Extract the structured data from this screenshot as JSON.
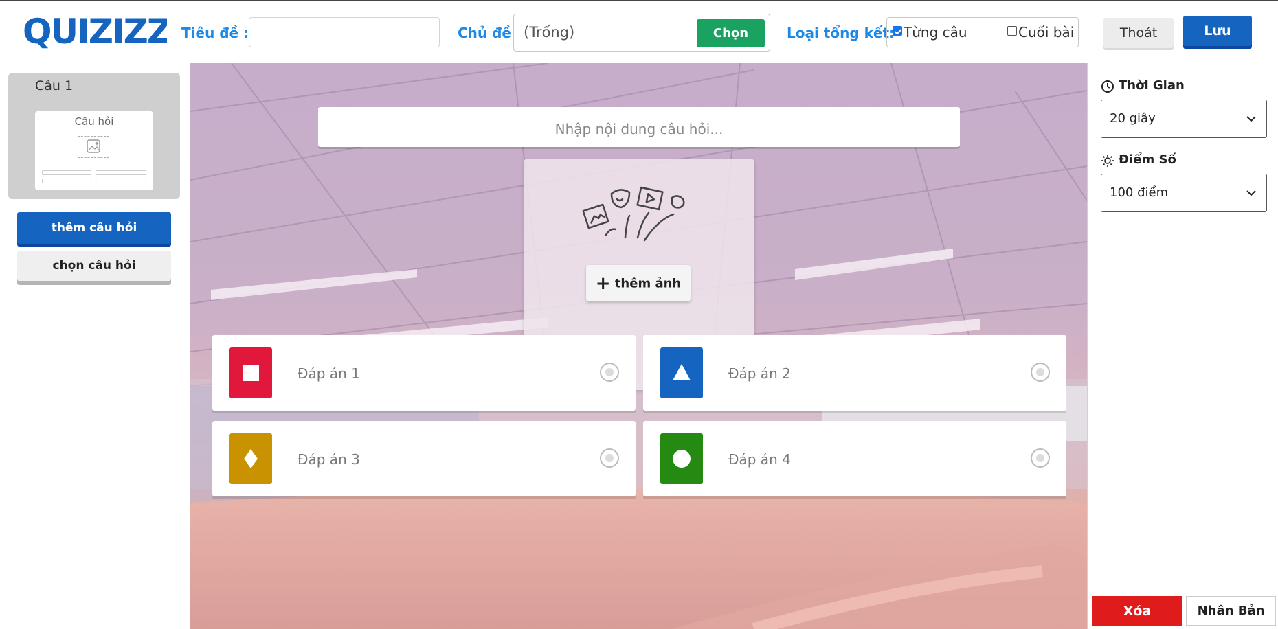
{
  "header": {
    "logo_text": "QUIZIZZ",
    "title_label": "Tiêu đề :",
    "title_value": "",
    "topic_label": "Chủ đề:",
    "topic_value": "(Trống)",
    "choose_label": "Chọn",
    "summary_label": "Loại tổng kết:",
    "summary_options": [
      {
        "label": "Từng câu",
        "checked": true
      },
      {
        "label": "Cuối bài",
        "checked": false
      }
    ],
    "exit_label": "Thoát",
    "save_label": "Lưu"
  },
  "sidebar": {
    "question_card": {
      "title": "Câu 1",
      "thumb_label": "Câu hỏi"
    },
    "add_question_label": "thêm câu hỏi",
    "choose_question_label": "chọn câu hỏi"
  },
  "editor": {
    "question_placeholder": "Nhập nội dung câu hỏi...",
    "add_image_label": "thêm ảnh",
    "answers": [
      {
        "placeholder": "Đáp án 1",
        "shape": "square-icon",
        "color": "#e2173c"
      },
      {
        "placeholder": "Đáp án 2",
        "shape": "triangle-icon",
        "color": "#1565c0"
      },
      {
        "placeholder": "Đáp án 3",
        "shape": "diamond-icon",
        "color": "#c99201"
      },
      {
        "placeholder": "Đáp án 4",
        "shape": "circle-icon",
        "color": "#248a12"
      }
    ]
  },
  "settings": {
    "time_label": "Thời Gian",
    "time_value": "20 giây",
    "points_label": "Điểm Số",
    "points_value": "100 điểm",
    "delete_label": "Xóa",
    "duplicate_label": "Nhân Bản"
  },
  "colors": {
    "brand_blue": "#1565c0",
    "label_blue": "#1e88e5",
    "choose_green": "#1aa260",
    "delete_red": "#e01b1b"
  }
}
